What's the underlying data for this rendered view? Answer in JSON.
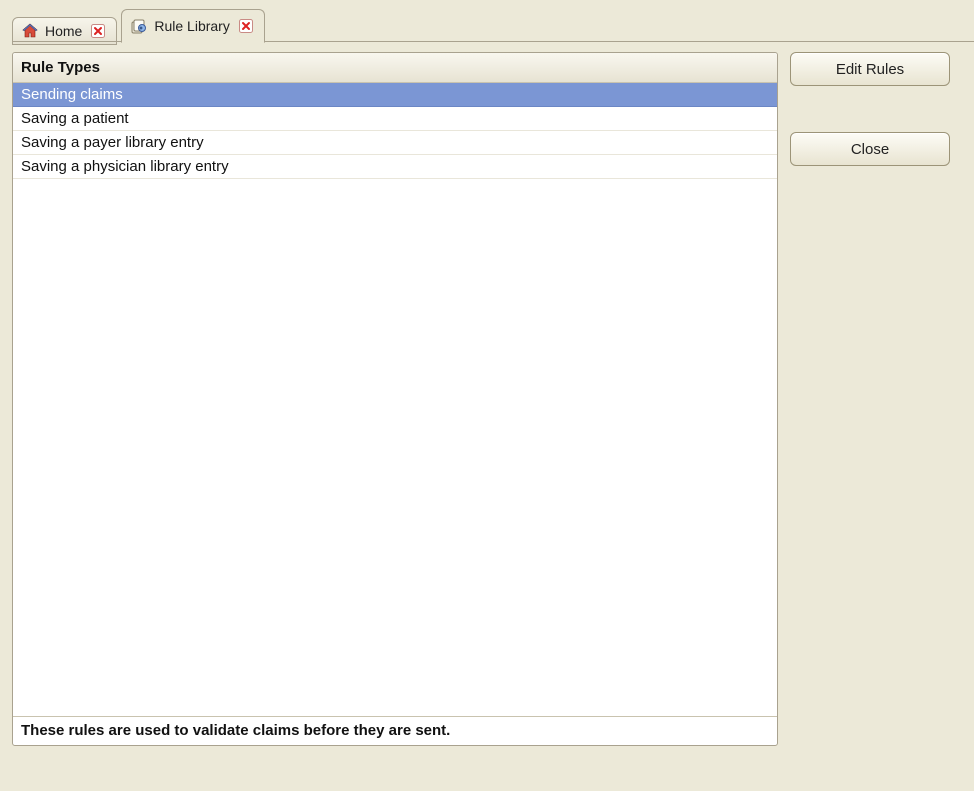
{
  "tabs": [
    {
      "label": "Home",
      "active": false
    },
    {
      "label": "Rule Library",
      "active": true
    }
  ],
  "list": {
    "header": "Rule Types",
    "rows": [
      "Sending claims",
      "Saving a patient",
      "Saving a payer library entry",
      "Saving a physician library entry"
    ],
    "selected_index": 0,
    "footer": "These rules are used to validate claims before they are sent."
  },
  "buttons": {
    "edit": "Edit Rules",
    "close": "Close"
  }
}
